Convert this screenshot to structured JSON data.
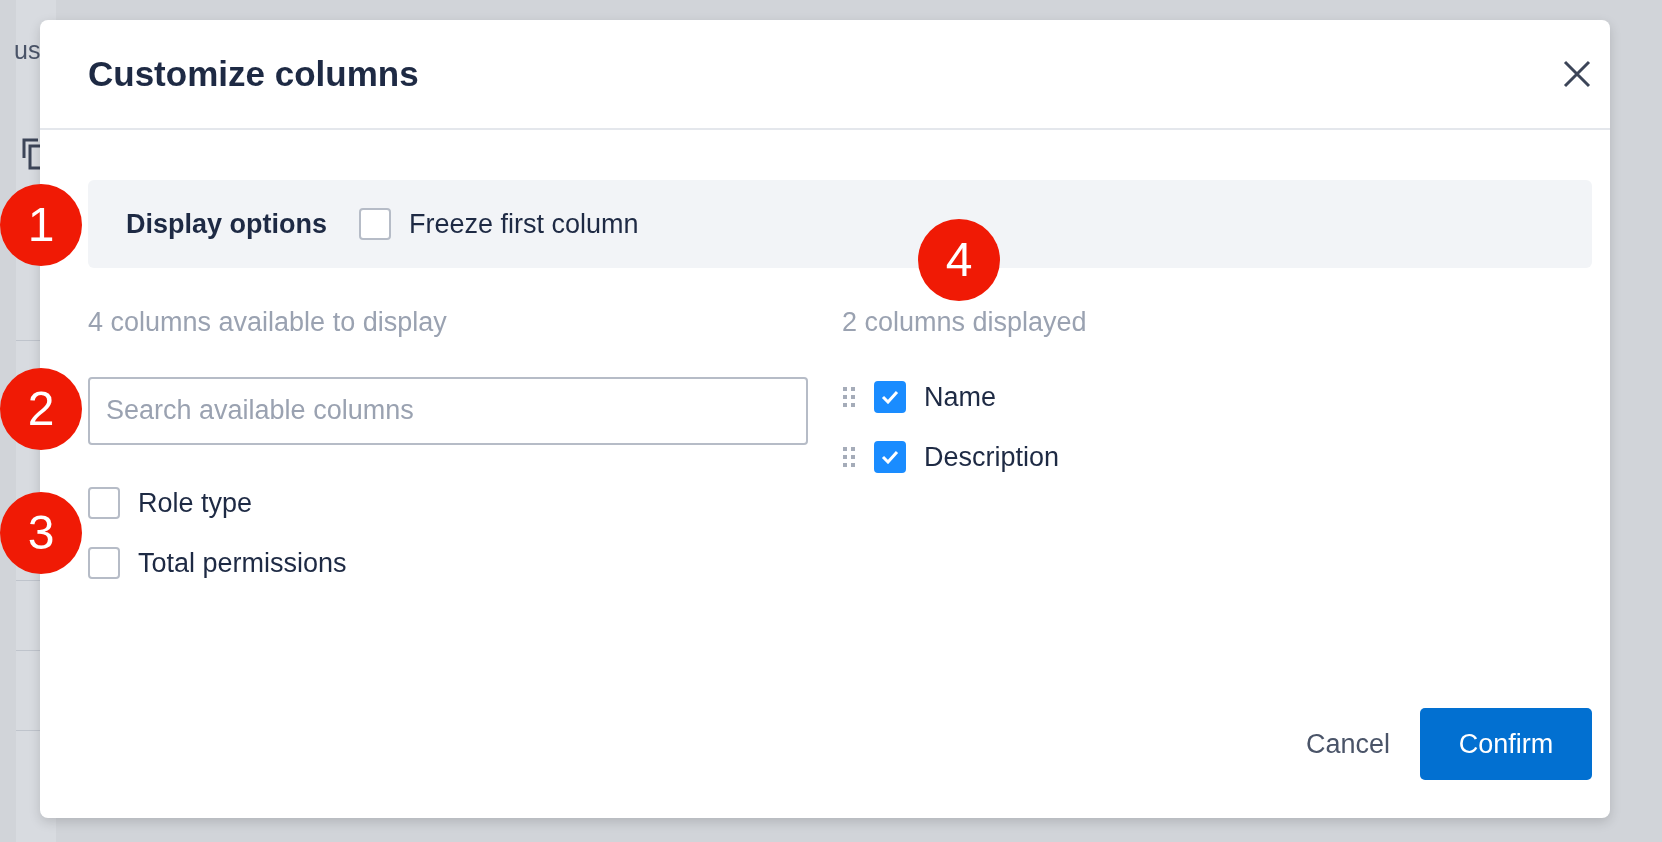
{
  "background": {
    "fragment": "us"
  },
  "dialog": {
    "title": "Customize columns"
  },
  "display_options": {
    "label": "Display options",
    "options": [
      {
        "label": "Freeze first column",
        "checked": false
      }
    ]
  },
  "available": {
    "heading": "4 columns available to display",
    "search": {
      "placeholder": "Search available columns"
    },
    "columns": [
      {
        "label": "Role type",
        "checked": false
      },
      {
        "label": "Total permissions",
        "checked": false
      }
    ]
  },
  "displayed": {
    "heading": "2 columns displayed",
    "columns": [
      {
        "label": "Name",
        "checked": true
      },
      {
        "label": "Description",
        "checked": true
      }
    ]
  },
  "buttons": [
    {
      "label": "Cancel",
      "kind": "link"
    },
    {
      "label": "Confirm",
      "kind": "primary"
    }
  ],
  "callouts": [
    "1",
    "2",
    "3",
    "4"
  ]
}
